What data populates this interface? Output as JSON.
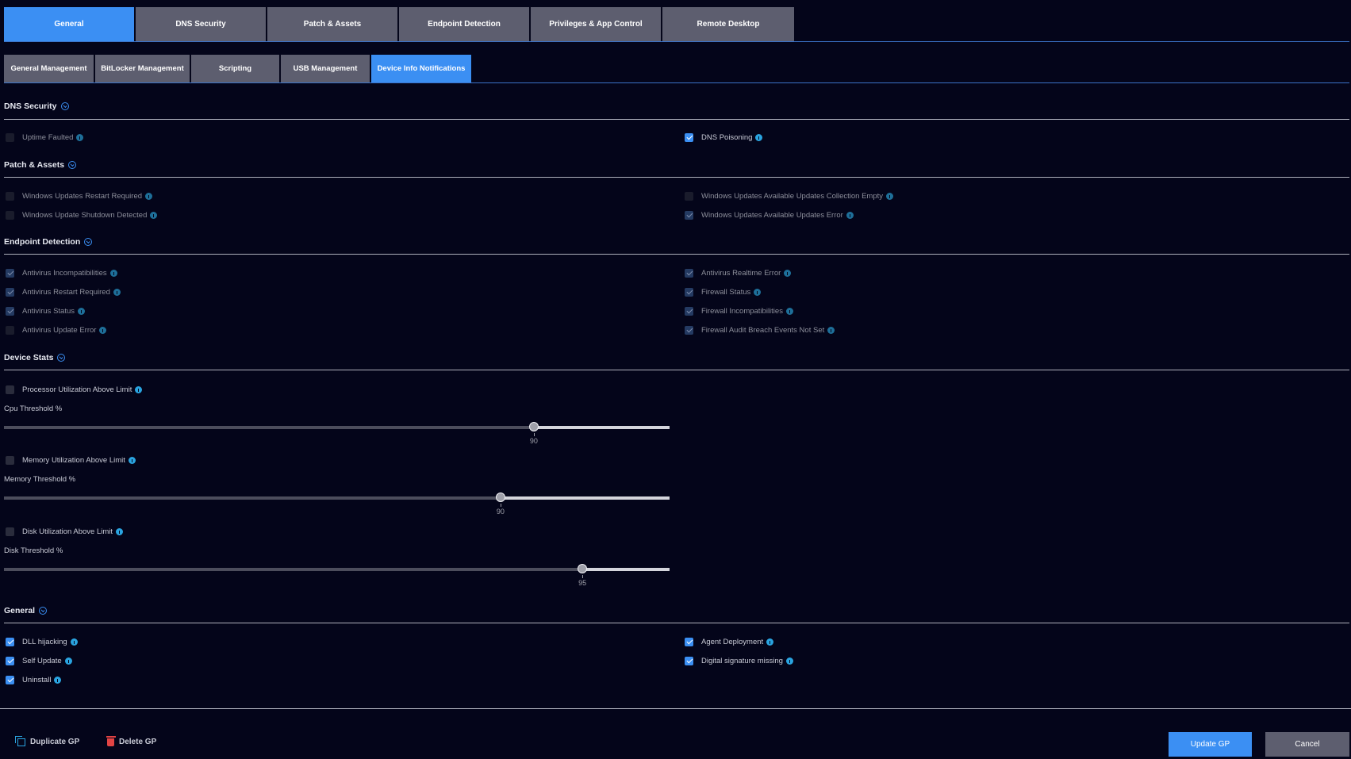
{
  "top_tabs": [
    "General",
    "DNS Security",
    "Patch & Assets",
    "Endpoint Detection",
    "Privileges & App Control",
    "Remote Desktop"
  ],
  "sub_tabs": [
    "General Management",
    "BitLocker Management",
    "Scripting",
    "USB Management",
    "Device Info Notifications"
  ],
  "sections": {
    "dns": {
      "title": "DNS Security",
      "left": [
        {
          "label": "Uptime Faulted",
          "checked": false
        }
      ],
      "right": [
        {
          "label": "DNS Poisoning",
          "checked": true
        }
      ]
    },
    "patch": {
      "title": "Patch & Assets",
      "left": [
        {
          "label": "Windows Updates Restart Required",
          "checked": false
        },
        {
          "label": "Windows Update Shutdown Detected",
          "checked": false
        }
      ],
      "right": [
        {
          "label": "Windows Updates Available Updates Collection Empty",
          "checked": false
        },
        {
          "label": "Windows Updates Available Updates Error",
          "checked": true
        }
      ]
    },
    "endpoint": {
      "title": "Endpoint Detection",
      "left": [
        {
          "label": "Antivirus Incompatibilities",
          "checked": true
        },
        {
          "label": "Antivirus Restart Required",
          "checked": true
        },
        {
          "label": "Antivirus Status",
          "checked": true
        },
        {
          "label": "Antivirus Update Error",
          "checked": false
        }
      ],
      "right": [
        {
          "label": "Antivirus Realtime Error",
          "checked": true
        },
        {
          "label": "Firewall Status",
          "checked": true
        },
        {
          "label": "Firewall Incompatibilities",
          "checked": true
        },
        {
          "label": "Firewall Audit Breach Events Not Set",
          "checked": true
        }
      ]
    },
    "stats": {
      "title": "Device Stats",
      "cpu": {
        "label": "Processor Utilization Above Limit",
        "checked": false,
        "threshold_label": "Cpu Threshold %",
        "value": 90,
        "position": 0.796
      },
      "memory": {
        "label": "Memory Utilization Above Limit",
        "checked": false,
        "threshold_label": "Memory Threshold %",
        "value": 90,
        "position": 0.746
      },
      "disk": {
        "label": "Disk Utilization Above Limit",
        "checked": false,
        "threshold_label": "Disk Threshold %",
        "value": 95,
        "position": 0.869
      }
    },
    "general": {
      "title": "General",
      "left": [
        {
          "label": "DLL hijacking",
          "checked": true
        },
        {
          "label": "Self Update",
          "checked": true
        },
        {
          "label": "Uninstall",
          "checked": true
        }
      ],
      "right": [
        {
          "label": "Agent Deployment",
          "checked": true
        },
        {
          "label": "Digital signature missing",
          "checked": true
        }
      ]
    }
  },
  "footer": {
    "duplicate": "Duplicate GP",
    "delete": "Delete GP",
    "update": "Update GP",
    "cancel": "Cancel"
  }
}
